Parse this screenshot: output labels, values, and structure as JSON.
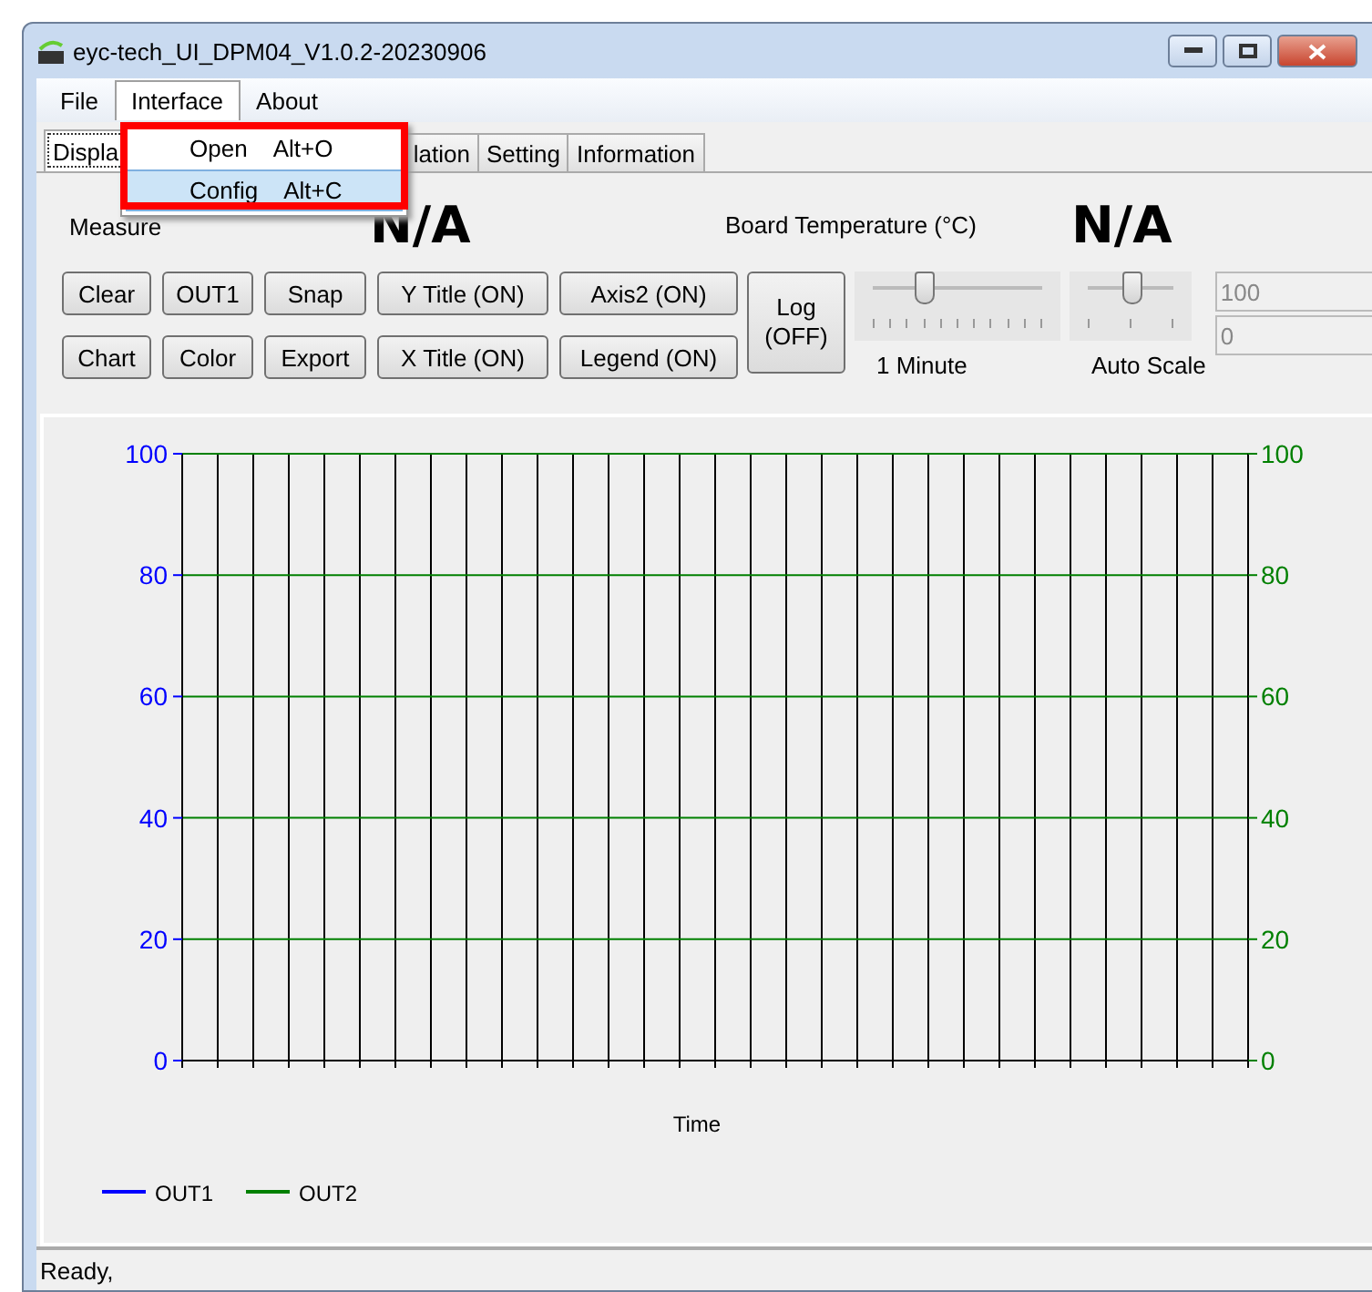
{
  "window": {
    "title": "eyc-tech_UI_DPM04_V1.0.2-20230906"
  },
  "menu": [
    {
      "label": "File",
      "selected": false
    },
    {
      "label": "Interface",
      "selected": true
    },
    {
      "label": "About",
      "selected": false
    }
  ],
  "dropdown": [
    {
      "label": "Open",
      "shortcut": "Alt+O",
      "selected": false
    },
    {
      "label": "Config",
      "shortcut": "Alt+C",
      "selected": true
    }
  ],
  "tabs": [
    {
      "label": "Displa",
      "selected": true
    },
    {
      "label": "lation",
      "selected": false
    },
    {
      "label": "Setting",
      "selected": false
    },
    {
      "label": "Information",
      "selected": false
    }
  ],
  "readings": [
    {
      "label": "Measure",
      "value": "N/A"
    },
    {
      "label": "Board Temperature (°C)",
      "value": "N/A"
    }
  ],
  "buttons": [
    [
      "Clear",
      "OUT1",
      "Snap",
      "Y Title (ON)",
      "Axis2 (ON)"
    ],
    [
      "Chart",
      "Color",
      "Export",
      "X Title (ON)",
      "Legend (ON)"
    ]
  ],
  "log_button": "Log\n(OFF)",
  "sliders": [
    {
      "label": "1 Minute",
      "level": 0.3
    },
    {
      "label": "Auto Scale",
      "level": 0.5
    }
  ],
  "spin_fields": [
    {
      "value": "100",
      "disabled": true
    },
    {
      "value": "0",
      "disabled": true
    }
  ],
  "chart": {
    "chart_data": {
      "type": "line",
      "xlabel": "Time",
      "ylim": [
        0,
        100
      ],
      "yticks": [
        0,
        20,
        40,
        60,
        80,
        100
      ],
      "y2lim": [
        0,
        100
      ],
      "y2ticks": [
        0,
        20,
        40,
        60,
        80,
        100
      ],
      "grid": true,
      "series": [
        {
          "name": "OUT1",
          "color": "#0000ff"
        },
        {
          "name": "OUT2",
          "color": "#008000"
        }
      ]
    }
  },
  "status_bar": "Ready,"
}
